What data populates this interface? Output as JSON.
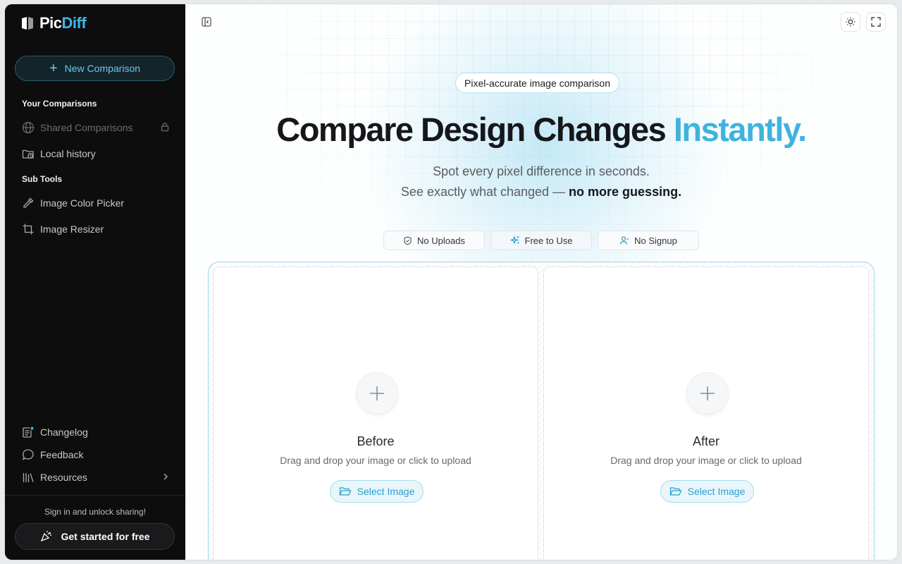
{
  "app": {
    "logo_prefix": "Pic",
    "logo_accent": "Diff"
  },
  "sidebar": {
    "new_comparison": "New Comparison",
    "your_comparisons_label": "Your Comparisons",
    "items": [
      {
        "label": "Shared Comparisons",
        "icon": "globe-icon",
        "locked": true
      },
      {
        "label": "Local history",
        "icon": "folder-clock-icon"
      }
    ],
    "sub_tools_label": "Sub Tools",
    "tools": [
      {
        "label": "Image Color Picker",
        "icon": "eyedropper-icon"
      },
      {
        "label": "Image Resizer",
        "icon": "crop-icon"
      }
    ],
    "bottom": [
      {
        "label": "Changelog",
        "icon": "changelog-icon"
      },
      {
        "label": "Feedback",
        "icon": "chat-bubble-icon"
      },
      {
        "label": "Resources",
        "icon": "library-icon"
      }
    ],
    "signin_text": "Sign in and unlock sharing!",
    "cta": "Get started for free"
  },
  "main": {
    "badge": "Pixel-accurate image comparison",
    "headline_main": "Compare Design Changes ",
    "headline_accent": "Instantly.",
    "sub1": "Spot every pixel difference in seconds.",
    "sub2_prefix": "See exactly what changed — ",
    "sub2_bold": "no more guessing.",
    "pills": [
      "No Uploads",
      "Free to Use",
      "No Signup"
    ],
    "panels": [
      {
        "title": "Before",
        "desc": "Drag and drop your image or click to upload",
        "button": "Select Image"
      },
      {
        "title": "After",
        "desc": "Drag and drop your image or click to upload",
        "button": "Select Image"
      }
    ]
  },
  "colors": {
    "accent": "#3eb3dd",
    "sidebar_bg": "#0d0d0e"
  }
}
